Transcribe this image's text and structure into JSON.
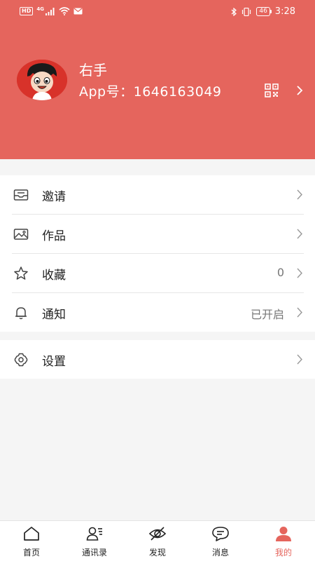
{
  "status_bar": {
    "hd": "HD",
    "signal_type": "4G",
    "battery": "46",
    "time": "3:28"
  },
  "profile": {
    "name": "右手",
    "app_id": "App号：1646163049"
  },
  "menu_group_1": [
    {
      "label": "邀请",
      "value": "",
      "icon": "envelope-icon"
    },
    {
      "label": "作品",
      "value": "",
      "icon": "image-icon"
    },
    {
      "label": "收藏",
      "value": "0",
      "icon": "star-icon"
    },
    {
      "label": "通知",
      "value": "已开启",
      "icon": "bell-icon"
    }
  ],
  "menu_group_2": [
    {
      "label": "设置",
      "value": "",
      "icon": "gear-icon"
    }
  ],
  "bottom_nav": [
    {
      "label": "首页",
      "icon": "home-icon"
    },
    {
      "label": "通讯录",
      "icon": "contacts-icon"
    },
    {
      "label": "发现",
      "icon": "discover-icon"
    },
    {
      "label": "消息",
      "icon": "message-icon"
    },
    {
      "label": "我的",
      "icon": "user-icon",
      "active": true
    }
  ],
  "colors": {
    "accent": "#e5655d",
    "background": "#f5f5f5"
  }
}
